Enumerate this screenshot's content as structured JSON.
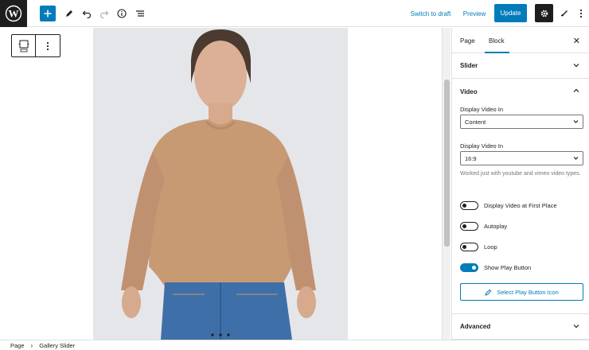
{
  "topbar": {
    "switch_to_draft": "Switch to draft",
    "preview": "Preview",
    "update": "Update",
    "icons": [
      "wordpress-logo",
      "plus",
      "pencil",
      "undo",
      "redo",
      "info",
      "list-view",
      "gear",
      "brush",
      "more-vertical"
    ]
  },
  "sidebar": {
    "tabs": [
      "Page",
      "Block"
    ],
    "active_tab": "Block",
    "slider_label": "Slider",
    "video": {
      "title": "Video",
      "display_video_in_label_1": "Display Video In",
      "display_video_in_value_1": "Content",
      "display_video_in_label_2": "Display Video In",
      "display_video_in_value_2": "16:9",
      "help_text": "Worked just with youtube and vimeo video types.",
      "toggles": [
        {
          "label": "Display Video at First Place",
          "on": false
        },
        {
          "label": "Autoplay",
          "on": false
        },
        {
          "label": "Loop",
          "on": false
        },
        {
          "label": "Show Play Button",
          "on": true
        }
      ],
      "select_icon_button": "Select Play Button Icon"
    },
    "advanced_label": "Advanced"
  },
  "breadcrumb": {
    "items": [
      "Page",
      "Gallery Slider"
    ]
  },
  "colors": {
    "accent": "#007cba",
    "dark": "#1e1e1e",
    "sweater": "#c79a74",
    "jeans": "#3f6fa8"
  }
}
